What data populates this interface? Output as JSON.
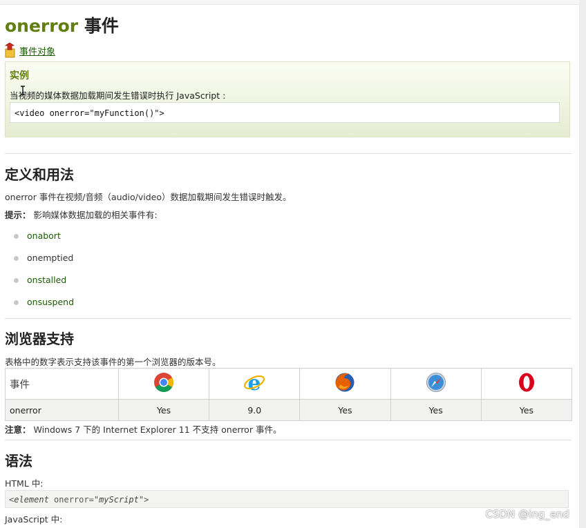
{
  "title": {
    "event": "onerror",
    "suffix": "事件"
  },
  "back_link": {
    "label": "事件对象",
    "icon": "back-arrow-icon"
  },
  "example": {
    "heading": "实例",
    "description": "当视频的媒体数据加载期间发生错误时执行 JavaScript :",
    "code": "<video onerror=\"myFunction()\">"
  },
  "definition": {
    "heading": "定义和用法",
    "text": "onerror 事件在视频/音频（audio/video）数据加载期间发生错误时触发。",
    "tip_label": "提示：",
    "tip_text": " 影响媒体数据加载的相关事件有:",
    "events": [
      {
        "label": "onabort",
        "link": true
      },
      {
        "label": "onemptied",
        "link": false
      },
      {
        "label": "onstalled",
        "link": true
      },
      {
        "label": "onsuspend",
        "link": true
      }
    ]
  },
  "browser_support": {
    "heading": "浏览器支持",
    "intro": "表格中的数字表示支持该事件的第一个浏览器的版本号。",
    "column_header": "事件",
    "browsers": [
      "chrome-icon",
      "internet-explorer-icon",
      "firefox-icon",
      "safari-icon",
      "opera-icon"
    ],
    "row": {
      "event": "onerror",
      "values": [
        "Yes",
        "9.0",
        "Yes",
        "Yes",
        "Yes"
      ]
    },
    "note_label": "注意：",
    "note_text": " Windows 7 下的 Internet Explorer 11 不支持 onerror 事件。"
  },
  "syntax": {
    "heading": "语法",
    "html_label": "HTML 中:",
    "html_code_prefix": "<",
    "html_code_element": "element",
    "html_code_mid": " onerror=\"",
    "html_code_script": "myScript",
    "html_code_suffix": "\">",
    "js_label": "JavaScript 中:"
  },
  "watermark": "CSDN @ing_end",
  "colors": {
    "accent_green": "#617f10",
    "link_green": "#1a5a00",
    "example_bg": "#e6edd2"
  }
}
